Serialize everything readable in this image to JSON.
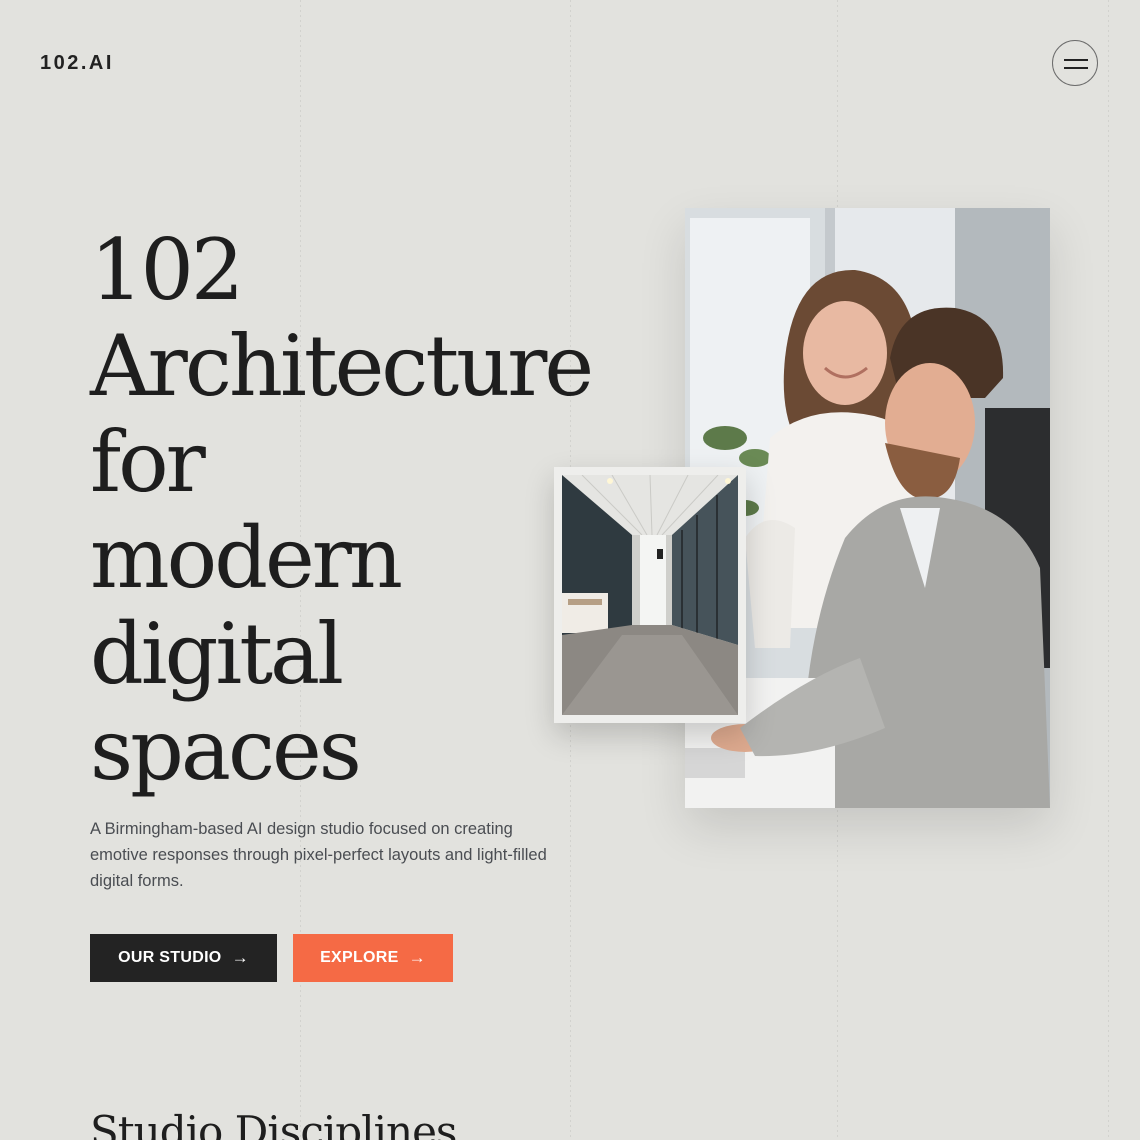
{
  "header": {
    "logo": "102.AI",
    "menu_icon": "hamburger-icon"
  },
  "hero": {
    "title_lines": [
      "102",
      "Architecture",
      "for",
      "modern",
      "digital",
      "spaces"
    ],
    "description": "A Birmingham-based AI design studio focused on creating emotive responses through pixel-perfect layouts and light-filled digital forms.",
    "buttons": {
      "studio_label": "OUR STUDIO",
      "explore_label": "EXPLORE",
      "arrow_icon": "arrow-right-icon"
    },
    "images": {
      "main": "photo-two-people-at-desk",
      "inset": "photo-office-corridor"
    }
  },
  "sections": {
    "disciplines_title": "Studio Disciplines"
  },
  "colors": {
    "background": "#e2e2de",
    "dark_button": "#232323",
    "accent": "#f56a45",
    "text": "#1e1e1e",
    "muted_text": "#4a4d52"
  }
}
